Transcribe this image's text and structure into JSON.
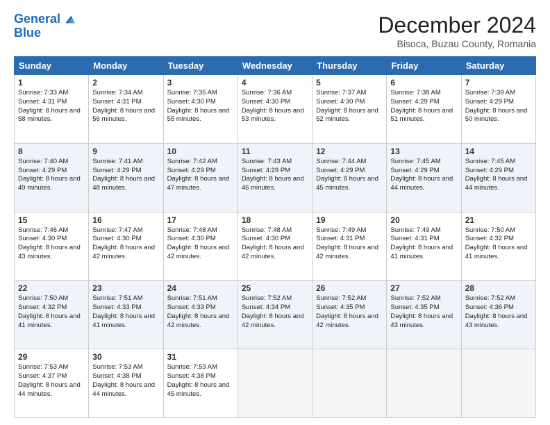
{
  "logo": {
    "line1": "General",
    "line2": "Blue"
  },
  "title": "December 2024",
  "location": "Bisoca, Buzau County, Romania",
  "weekdays": [
    "Sunday",
    "Monday",
    "Tuesday",
    "Wednesday",
    "Thursday",
    "Friday",
    "Saturday"
  ],
  "weeks": [
    [
      {
        "day": 1,
        "sunrise": "7:33 AM",
        "sunset": "4:31 PM",
        "daylight": "8 hours and 58 minutes."
      },
      {
        "day": 2,
        "sunrise": "7:34 AM",
        "sunset": "4:31 PM",
        "daylight": "8 hours and 56 minutes."
      },
      {
        "day": 3,
        "sunrise": "7:35 AM",
        "sunset": "4:30 PM",
        "daylight": "8 hours and 55 minutes."
      },
      {
        "day": 4,
        "sunrise": "7:36 AM",
        "sunset": "4:30 PM",
        "daylight": "8 hours and 53 minutes."
      },
      {
        "day": 5,
        "sunrise": "7:37 AM",
        "sunset": "4:30 PM",
        "daylight": "8 hours and 52 minutes."
      },
      {
        "day": 6,
        "sunrise": "7:38 AM",
        "sunset": "4:29 PM",
        "daylight": "8 hours and 51 minutes."
      },
      {
        "day": 7,
        "sunrise": "7:39 AM",
        "sunset": "4:29 PM",
        "daylight": "8 hours and 50 minutes."
      }
    ],
    [
      {
        "day": 8,
        "sunrise": "7:40 AM",
        "sunset": "4:29 PM",
        "daylight": "8 hours and 49 minutes."
      },
      {
        "day": 9,
        "sunrise": "7:41 AM",
        "sunset": "4:29 PM",
        "daylight": "8 hours and 48 minutes."
      },
      {
        "day": 10,
        "sunrise": "7:42 AM",
        "sunset": "4:29 PM",
        "daylight": "8 hours and 47 minutes."
      },
      {
        "day": 11,
        "sunrise": "7:43 AM",
        "sunset": "4:29 PM",
        "daylight": "8 hours and 46 minutes."
      },
      {
        "day": 12,
        "sunrise": "7:44 AM",
        "sunset": "4:29 PM",
        "daylight": "8 hours and 45 minutes."
      },
      {
        "day": 13,
        "sunrise": "7:45 AM",
        "sunset": "4:29 PM",
        "daylight": "8 hours and 44 minutes."
      },
      {
        "day": 14,
        "sunrise": "7:45 AM",
        "sunset": "4:29 PM",
        "daylight": "8 hours and 44 minutes."
      }
    ],
    [
      {
        "day": 15,
        "sunrise": "7:46 AM",
        "sunset": "4:30 PM",
        "daylight": "8 hours and 43 minutes."
      },
      {
        "day": 16,
        "sunrise": "7:47 AM",
        "sunset": "4:30 PM",
        "daylight": "8 hours and 42 minutes."
      },
      {
        "day": 17,
        "sunrise": "7:48 AM",
        "sunset": "4:30 PM",
        "daylight": "8 hours and 42 minutes."
      },
      {
        "day": 18,
        "sunrise": "7:48 AM",
        "sunset": "4:30 PM",
        "daylight": "8 hours and 42 minutes."
      },
      {
        "day": 19,
        "sunrise": "7:49 AM",
        "sunset": "4:31 PM",
        "daylight": "8 hours and 42 minutes."
      },
      {
        "day": 20,
        "sunrise": "7:49 AM",
        "sunset": "4:31 PM",
        "daylight": "8 hours and 41 minutes."
      },
      {
        "day": 21,
        "sunrise": "7:50 AM",
        "sunset": "4:32 PM",
        "daylight": "8 hours and 41 minutes."
      }
    ],
    [
      {
        "day": 22,
        "sunrise": "7:50 AM",
        "sunset": "4:32 PM",
        "daylight": "8 hours and 41 minutes."
      },
      {
        "day": 23,
        "sunrise": "7:51 AM",
        "sunset": "4:33 PM",
        "daylight": "8 hours and 41 minutes."
      },
      {
        "day": 24,
        "sunrise": "7:51 AM",
        "sunset": "4:33 PM",
        "daylight": "8 hours and 42 minutes."
      },
      {
        "day": 25,
        "sunrise": "7:52 AM",
        "sunset": "4:34 PM",
        "daylight": "8 hours and 42 minutes."
      },
      {
        "day": 26,
        "sunrise": "7:52 AM",
        "sunset": "4:35 PM",
        "daylight": "8 hours and 42 minutes."
      },
      {
        "day": 27,
        "sunrise": "7:52 AM",
        "sunset": "4:35 PM",
        "daylight": "8 hours and 43 minutes."
      },
      {
        "day": 28,
        "sunrise": "7:52 AM",
        "sunset": "4:36 PM",
        "daylight": "8 hours and 43 minutes."
      }
    ],
    [
      {
        "day": 29,
        "sunrise": "7:53 AM",
        "sunset": "4:37 PM",
        "daylight": "8 hours and 44 minutes."
      },
      {
        "day": 30,
        "sunrise": "7:53 AM",
        "sunset": "4:38 PM",
        "daylight": "8 hours and 44 minutes."
      },
      {
        "day": 31,
        "sunrise": "7:53 AM",
        "sunset": "4:38 PM",
        "daylight": "8 hours and 45 minutes."
      },
      null,
      null,
      null,
      null
    ]
  ]
}
